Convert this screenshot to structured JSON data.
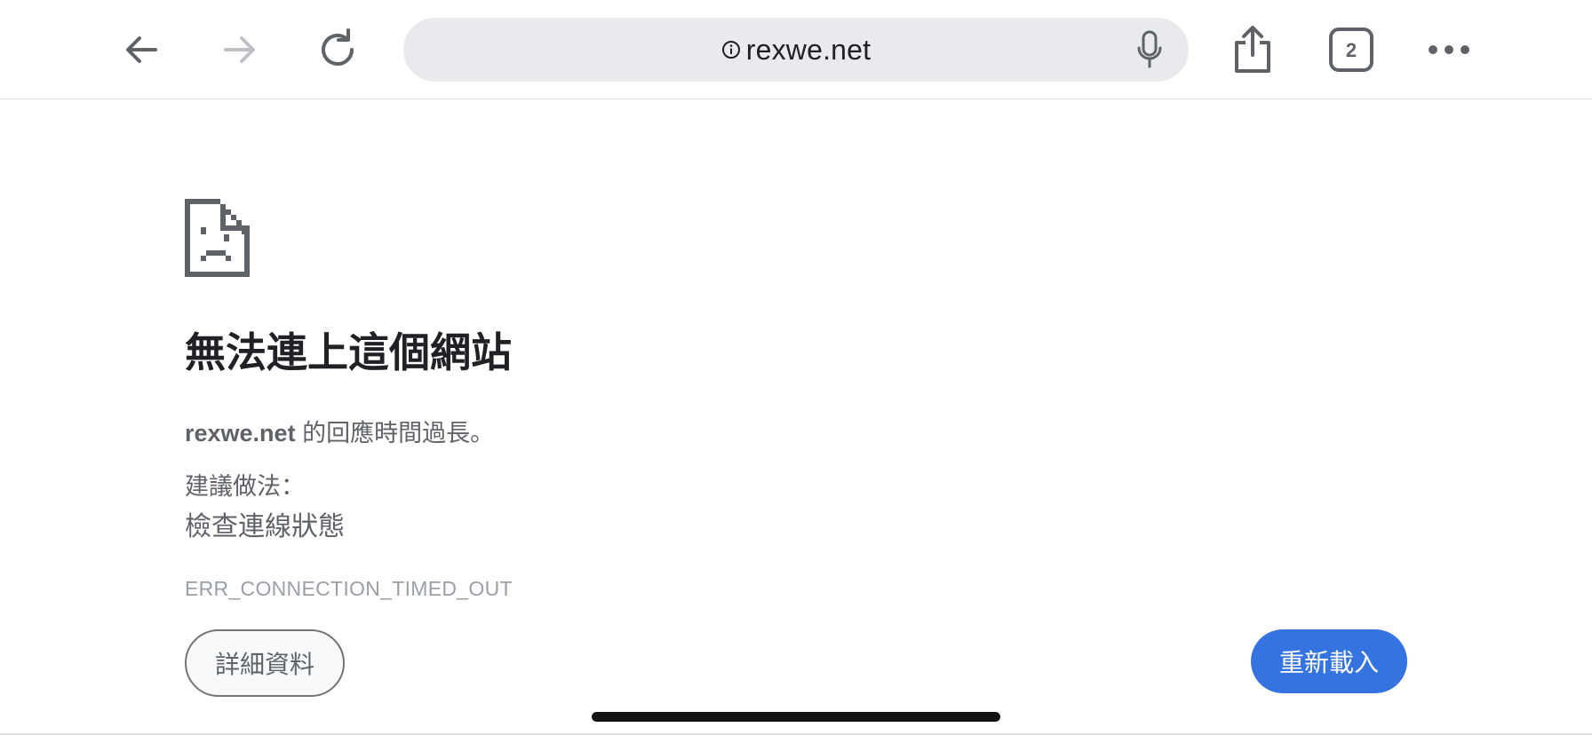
{
  "toolbar": {
    "back_icon": "arrow-left-icon",
    "forward_icon": "arrow-right-icon",
    "reload_icon": "reload-icon",
    "share_icon": "share-icon",
    "tabs_icon": "tabs-icon",
    "tab_count": "2",
    "menu_icon": "more-horizontal-icon"
  },
  "omnibox": {
    "url": "rexwe.net",
    "info_icon": "info-icon",
    "mic_icon": "microphone-icon"
  },
  "error_page": {
    "icon": "sad-page-icon",
    "heading": "無法連上這個網站",
    "host": "rexwe.net",
    "summary_suffix": " 的回應時間過長。",
    "suggestions_label": "建議做法：",
    "suggestion_1": "檢查連線狀態",
    "error_code": "ERR_CONNECTION_TIMED_OUT",
    "details_label": "詳細資料",
    "reload_label": "重新載入"
  },
  "colors": {
    "primary_button": "#3574e0",
    "toolbar_icon": "#5f6368",
    "omnibox_bg": "#e8eaed"
  }
}
